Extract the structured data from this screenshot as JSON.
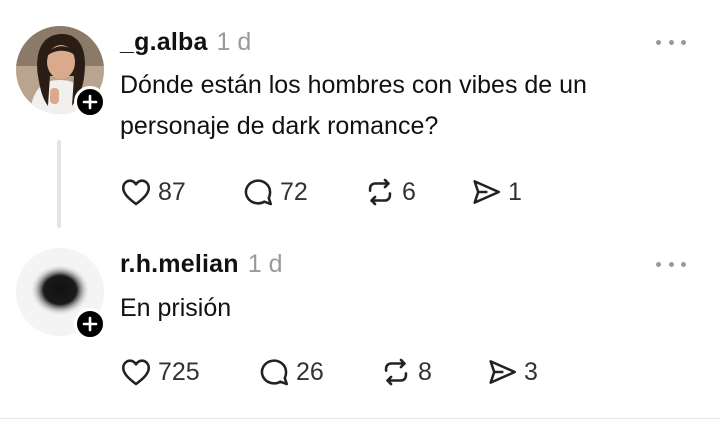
{
  "posts": [
    {
      "username": "_g.alba",
      "time": "1 d",
      "text": "Dónde están los hombres con vibes de un personaje de dark romance?",
      "likes": "87",
      "replies": "72",
      "reposts": "6",
      "shares": "1"
    },
    {
      "username": "r.h.melian",
      "time": "1 d",
      "text": "En prisión",
      "likes": "725",
      "replies": "26",
      "reposts": "8",
      "shares": "3"
    }
  ],
  "icons": {
    "like": "heart-icon",
    "reply": "comment-icon",
    "repost": "repost-icon",
    "share": "send-icon",
    "follow": "plus-icon",
    "more": "more-dots-icon"
  }
}
